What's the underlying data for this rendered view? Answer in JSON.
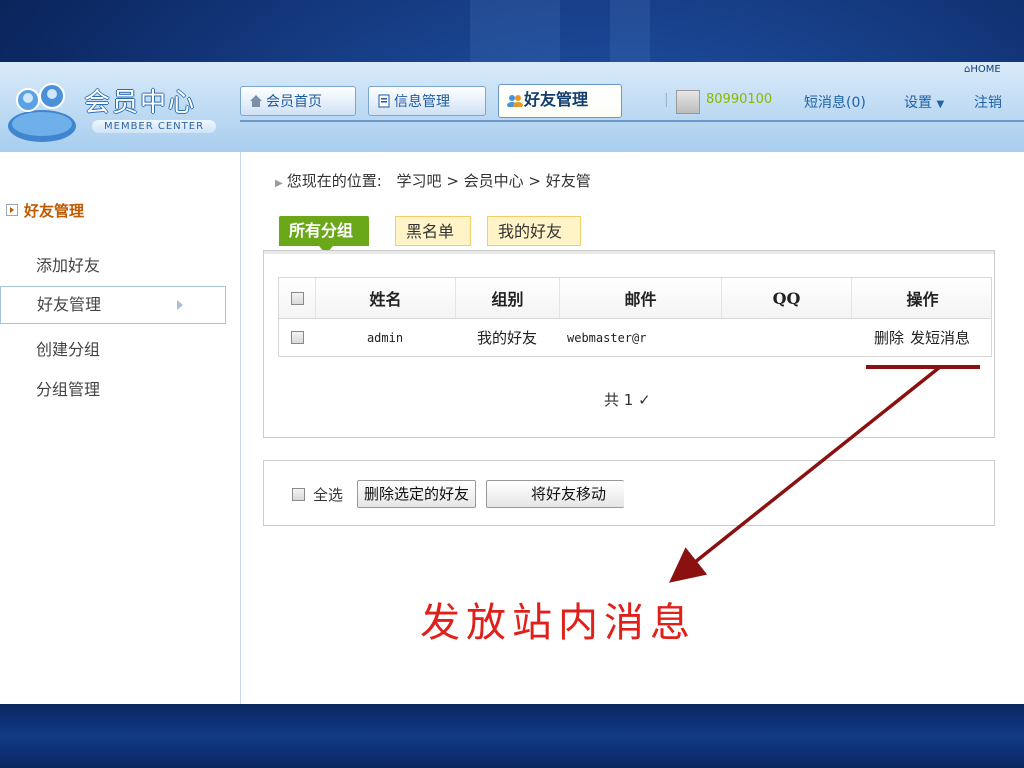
{
  "app": {
    "logo_title": "会员中心",
    "logo_subtitle": "MEMBER CENTER",
    "home_badge": "HOME"
  },
  "nav": {
    "tabs": [
      {
        "label": "会员首页",
        "icon": "house-icon"
      },
      {
        "label": "信息管理",
        "icon": "document-icon"
      },
      {
        "label": "好友管理",
        "icon": "users-icon",
        "active": true
      }
    ],
    "user_id": "80990100",
    "messages": "短消息(0)",
    "settings": "设置",
    "logout": "注销"
  },
  "sidebar": {
    "title": "好友管理",
    "items": [
      {
        "label": "添加好友"
      },
      {
        "label": "好友管理",
        "active": true
      },
      {
        "label": "创建分组"
      },
      {
        "label": "分组管理"
      }
    ]
  },
  "breadcrumb": {
    "prefix": "您现在的位置:",
    "path": "学习吧 > 会员中心 > 好友管"
  },
  "tabs": {
    "all_groups": "所有分组",
    "blacklist": "黑名单",
    "my_friends": "我的好友"
  },
  "table": {
    "headers": [
      "姓名",
      "组别",
      "邮件",
      "QQ",
      "操作"
    ],
    "rows": [
      {
        "name": "admin",
        "group": "我的好友",
        "email": "webmaster@r",
        "qq": "",
        "action_delete": "删除",
        "action_message": "发短消息"
      }
    ],
    "total_text": "共 1 ✓"
  },
  "bulk": {
    "select_all": "全选",
    "delete_selected": "删除选定的好友",
    "move_to": "将好友移动"
  },
  "annotation": {
    "text": "发放站内消息",
    "color": "#e0201a",
    "arrow_color": "#8b1111"
  },
  "colors": {
    "accent_green": "#6aa719",
    "link_blue": "#2063a6",
    "user_id_green": "#8bb600"
  }
}
